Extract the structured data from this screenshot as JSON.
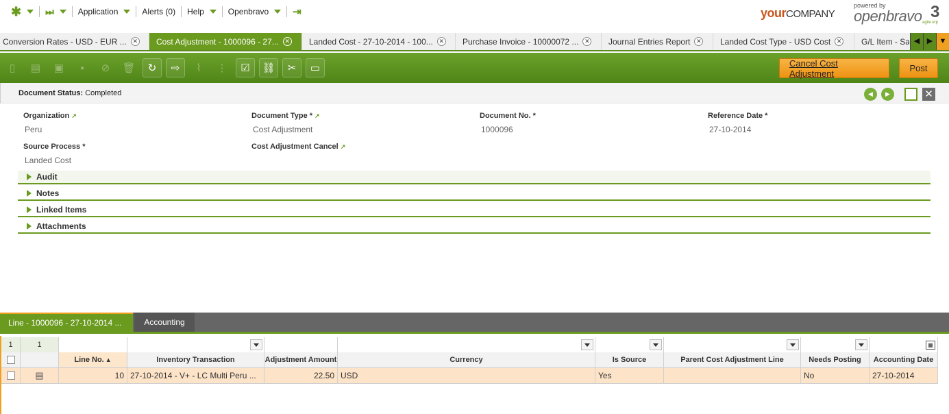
{
  "topmenu": {
    "application": "Application",
    "alerts": "Alerts (0)",
    "help": "Help",
    "openbravo": "Openbravo"
  },
  "brand": {
    "company_bold": "your",
    "company_rest": "COMPANY",
    "powered_by": "powered by",
    "openbravo": "openbravo",
    "tagline": "agile erp",
    "version": "3"
  },
  "tabs": [
    {
      "label": "Conversion Rates - USD - EUR ..."
    },
    {
      "label": "Cost Adjustment - 1000096 - 27..."
    },
    {
      "label": "Landed Cost - 27-10-2014 - 100..."
    },
    {
      "label": "Purchase Invoice - 10000072 ..."
    },
    {
      "label": "Journal Entries Report"
    },
    {
      "label": "Landed Cost Type - USD Cost"
    },
    {
      "label": "G/L Item - Sa"
    }
  ],
  "actions": {
    "cancel_label": "Cancel Cost Adjustment",
    "post_label": "Post"
  },
  "status": {
    "label": "Document Status:",
    "value": "Completed"
  },
  "fields": {
    "organization": {
      "label": "Organization",
      "value": "Peru"
    },
    "document_type": {
      "label": "Document Type *",
      "value": "Cost Adjustment"
    },
    "document_no": {
      "label": "Document No. *",
      "value": "1000096"
    },
    "reference_date": {
      "label": "Reference Date *",
      "value": "27-10-2014"
    },
    "source_process": {
      "label": "Source Process *",
      "value": "Landed Cost"
    },
    "cost_adjustment_cancel": {
      "label": "Cost Adjustment Cancel",
      "value": ""
    }
  },
  "sections": [
    "Audit",
    "Notes",
    "Linked Items",
    "Attachments"
  ],
  "child_tabs": {
    "line": "Line - 1000096 - 27-10-2014 ...",
    "accounting": "Accounting"
  },
  "grid": {
    "filter_count": "1",
    "filter_count2": "1",
    "columns": {
      "line_no": "Line No.",
      "inventory_transaction": "Inventory Transaction",
      "adjustment_amount": "Adjustment Amount",
      "currency": "Currency",
      "is_source": "Is Source",
      "parent_line": "Parent Cost Adjustment Line",
      "needs_posting": "Needs Posting",
      "accounting_date": "Accounting Date"
    },
    "rows": [
      {
        "line_no": "10",
        "inventory_transaction": "27-10-2014 - V+ - LC Multi Peru ...",
        "adjustment_amount": "22.50",
        "currency": "USD",
        "is_source": "Yes",
        "parent_line": "",
        "needs_posting": "No",
        "accounting_date": "27-10-2014"
      }
    ]
  }
}
